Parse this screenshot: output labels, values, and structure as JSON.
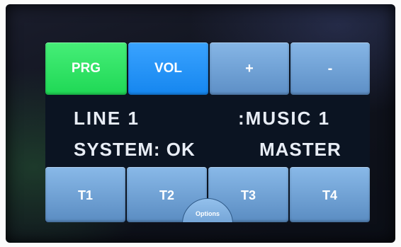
{
  "top_buttons": {
    "prg": "PRG",
    "vol": "VOL",
    "plus": "+",
    "minus": "-"
  },
  "display": {
    "line1_left": "LINE 1",
    "line1_right": ":MUSIC 1",
    "line2_left": "SYSTEM: OK",
    "line2_right": "MASTER"
  },
  "bottom_buttons": [
    "T1",
    "T2",
    "T3",
    "T4"
  ],
  "options_label": "Options",
  "colors": {
    "prg_active": "#1fd855",
    "vol_active": "#1586ef",
    "button_default": "#5d8fc6",
    "screen_bg": "#0b1422",
    "text": "#e8edf5"
  }
}
